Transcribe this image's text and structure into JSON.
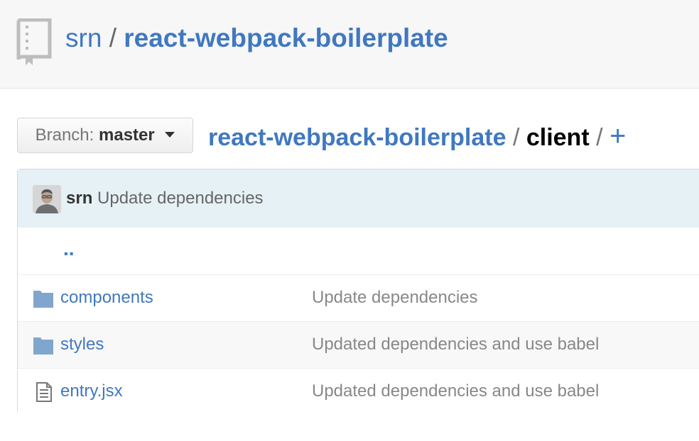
{
  "repo": {
    "owner": "srn",
    "separator": "/",
    "name": "react-webpack-boilerplate"
  },
  "branch": {
    "label": "Branch:",
    "name": "master"
  },
  "breadcrumb": {
    "root": "react-webpack-boilerplate",
    "separator": "/",
    "current": "client",
    "add": "+"
  },
  "latest_commit": {
    "author": "srn",
    "message": "Update dependencies"
  },
  "parent_dir": "..",
  "files": [
    {
      "type": "folder",
      "icon": "folder-icon",
      "name": "components",
      "message": "Update dependencies"
    },
    {
      "type": "folder",
      "icon": "folder-icon",
      "name": "styles",
      "message": "Updated dependencies and use babel"
    },
    {
      "type": "file",
      "icon": "file-text-icon",
      "name": "entry.jsx",
      "message": "Updated dependencies and use babel"
    }
  ],
  "colors": {
    "link": "#4078c0",
    "commit_bar": "#e6f1f6",
    "header_bg": "#f7f7f7"
  }
}
